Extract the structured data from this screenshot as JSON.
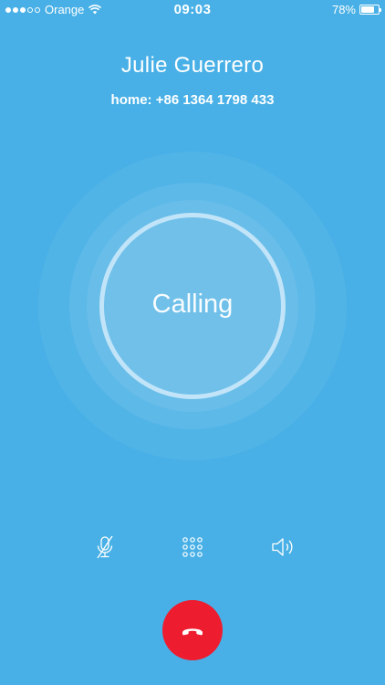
{
  "status_bar": {
    "carrier": "Orange",
    "time": "09:03",
    "battery": "78%",
    "battery_level": 0.78,
    "signal_bars": 3,
    "signal_total": 5
  },
  "call": {
    "contact_name": "Julie Guerrero",
    "number": "home: +86 1364 1798 433",
    "status": "Calling"
  },
  "controls": {
    "mute_icon": "mic-off-icon",
    "keypad_icon": "keypad-icon",
    "speaker_icon": "speaker-icon",
    "end_call_icon": "phone-hangup-icon"
  },
  "colors": {
    "background": "#48b0e6",
    "end_call": "#ee1c2f",
    "text": "#ffffff"
  }
}
